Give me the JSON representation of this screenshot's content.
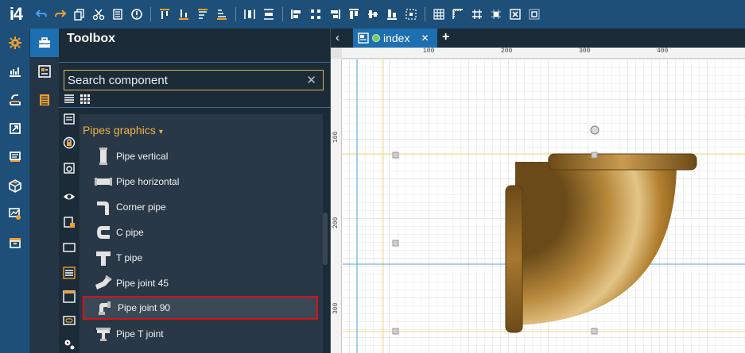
{
  "app": {
    "logo": "i4"
  },
  "toolbar": {
    "icons": [
      "undo-icon",
      "redo-icon",
      "copy-icon",
      "cut-icon",
      "delete-icon",
      "info-icon",
      "align-top-icon",
      "align-bottom-icon",
      "align-top-alt-icon",
      "align-bottom-alt-icon",
      "distribute-horizontal-icon",
      "distribute-vertical-icon",
      "align-left-icon",
      "align-center-icon",
      "align-right-icon",
      "align-top-edge-icon",
      "align-middle-icon",
      "align-bottom-edge-icon",
      "center-icon",
      "grid-icon",
      "ruler-icon",
      "snap-grid-icon",
      "snap-object-icon",
      "zoom-fit-icon",
      "layout-icon"
    ]
  },
  "rail": {
    "icons": [
      "settings-icon",
      "dashboard-icon",
      "import-icon",
      "export-icon",
      "monitor-icon",
      "package-icon",
      "analytics-gear-icon",
      "archive-icon"
    ]
  },
  "rail2": {
    "icons": [
      "toolbox-icon",
      "components-icon",
      "document-icon"
    ]
  },
  "toolbox": {
    "title": "Toolbox",
    "search": {
      "value": "Search component",
      "placeholder": "Search component",
      "clear": "✕"
    },
    "category": {
      "label": "Pipes graphics",
      "caret": "▾"
    },
    "items": [
      {
        "label": "Pipe vertical",
        "icon": "pipe-vertical-icon"
      },
      {
        "label": "Pipe horizontal",
        "icon": "pipe-horizontal-icon"
      },
      {
        "label": "Corner pipe",
        "icon": "corner-pipe-icon"
      },
      {
        "label": "C pipe",
        "icon": "c-pipe-icon"
      },
      {
        "label": "T pipe",
        "icon": "t-pipe-icon"
      },
      {
        "label": "Pipe joint 45",
        "icon": "pipe-joint-45-icon"
      },
      {
        "label": "Pipe joint 90",
        "icon": "pipe-joint-90-icon",
        "selected": true
      },
      {
        "label": "Pipe T joint",
        "icon": "pipe-t-joint-icon"
      }
    ]
  },
  "tabs": {
    "back": "‹",
    "active": {
      "label": "index",
      "close": "✕",
      "status_color": "#6fcf5a"
    },
    "add": "+"
  },
  "canvas": {
    "ruler_top": [
      "100",
      "200",
      "300",
      "400"
    ],
    "ruler_left": [
      "100",
      "200",
      "300"
    ]
  },
  "colors": {
    "accent": "#1e6fb0",
    "toolbar": "#1d4f79",
    "category": "#f0b047",
    "selection": "#d2141b",
    "brass": "#c3923f"
  }
}
